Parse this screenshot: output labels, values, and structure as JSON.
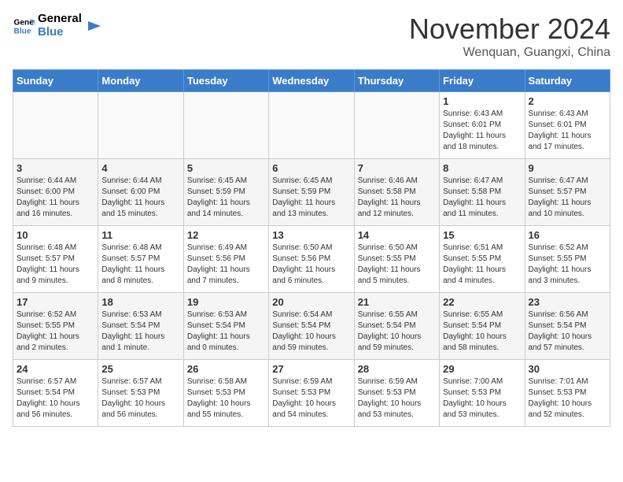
{
  "header": {
    "logo_line1": "General",
    "logo_line2": "Blue",
    "month": "November 2024",
    "location": "Wenquan, Guangxi, China"
  },
  "weekdays": [
    "Sunday",
    "Monday",
    "Tuesday",
    "Wednesday",
    "Thursday",
    "Friday",
    "Saturday"
  ],
  "weeks": [
    [
      {
        "day": "",
        "info": ""
      },
      {
        "day": "",
        "info": ""
      },
      {
        "day": "",
        "info": ""
      },
      {
        "day": "",
        "info": ""
      },
      {
        "day": "",
        "info": ""
      },
      {
        "day": "1",
        "info": "Sunrise: 6:43 AM\nSunset: 6:01 PM\nDaylight: 11 hours\nand 18 minutes."
      },
      {
        "day": "2",
        "info": "Sunrise: 6:43 AM\nSunset: 6:01 PM\nDaylight: 11 hours\nand 17 minutes."
      }
    ],
    [
      {
        "day": "3",
        "info": "Sunrise: 6:44 AM\nSunset: 6:00 PM\nDaylight: 11 hours\nand 16 minutes."
      },
      {
        "day": "4",
        "info": "Sunrise: 6:44 AM\nSunset: 6:00 PM\nDaylight: 11 hours\nand 15 minutes."
      },
      {
        "day": "5",
        "info": "Sunrise: 6:45 AM\nSunset: 5:59 PM\nDaylight: 11 hours\nand 14 minutes."
      },
      {
        "day": "6",
        "info": "Sunrise: 6:45 AM\nSunset: 5:59 PM\nDaylight: 11 hours\nand 13 minutes."
      },
      {
        "day": "7",
        "info": "Sunrise: 6:46 AM\nSunset: 5:58 PM\nDaylight: 11 hours\nand 12 minutes."
      },
      {
        "day": "8",
        "info": "Sunrise: 6:47 AM\nSunset: 5:58 PM\nDaylight: 11 hours\nand 11 minutes."
      },
      {
        "day": "9",
        "info": "Sunrise: 6:47 AM\nSunset: 5:57 PM\nDaylight: 11 hours\nand 10 minutes."
      }
    ],
    [
      {
        "day": "10",
        "info": "Sunrise: 6:48 AM\nSunset: 5:57 PM\nDaylight: 11 hours\nand 9 minutes."
      },
      {
        "day": "11",
        "info": "Sunrise: 6:48 AM\nSunset: 5:57 PM\nDaylight: 11 hours\nand 8 minutes."
      },
      {
        "day": "12",
        "info": "Sunrise: 6:49 AM\nSunset: 5:56 PM\nDaylight: 11 hours\nand 7 minutes."
      },
      {
        "day": "13",
        "info": "Sunrise: 6:50 AM\nSunset: 5:56 PM\nDaylight: 11 hours\nand 6 minutes."
      },
      {
        "day": "14",
        "info": "Sunrise: 6:50 AM\nSunset: 5:55 PM\nDaylight: 11 hours\nand 5 minutes."
      },
      {
        "day": "15",
        "info": "Sunrise: 6:51 AM\nSunset: 5:55 PM\nDaylight: 11 hours\nand 4 minutes."
      },
      {
        "day": "16",
        "info": "Sunrise: 6:52 AM\nSunset: 5:55 PM\nDaylight: 11 hours\nand 3 minutes."
      }
    ],
    [
      {
        "day": "17",
        "info": "Sunrise: 6:52 AM\nSunset: 5:55 PM\nDaylight: 11 hours\nand 2 minutes."
      },
      {
        "day": "18",
        "info": "Sunrise: 6:53 AM\nSunset: 5:54 PM\nDaylight: 11 hours\nand 1 minute."
      },
      {
        "day": "19",
        "info": "Sunrise: 6:53 AM\nSunset: 5:54 PM\nDaylight: 11 hours\nand 0 minutes."
      },
      {
        "day": "20",
        "info": "Sunrise: 6:54 AM\nSunset: 5:54 PM\nDaylight: 10 hours\nand 59 minutes."
      },
      {
        "day": "21",
        "info": "Sunrise: 6:55 AM\nSunset: 5:54 PM\nDaylight: 10 hours\nand 59 minutes."
      },
      {
        "day": "22",
        "info": "Sunrise: 6:55 AM\nSunset: 5:54 PM\nDaylight: 10 hours\nand 58 minutes."
      },
      {
        "day": "23",
        "info": "Sunrise: 6:56 AM\nSunset: 5:54 PM\nDaylight: 10 hours\nand 57 minutes."
      }
    ],
    [
      {
        "day": "24",
        "info": "Sunrise: 6:57 AM\nSunset: 5:54 PM\nDaylight: 10 hours\nand 56 minutes."
      },
      {
        "day": "25",
        "info": "Sunrise: 6:57 AM\nSunset: 5:53 PM\nDaylight: 10 hours\nand 56 minutes."
      },
      {
        "day": "26",
        "info": "Sunrise: 6:58 AM\nSunset: 5:53 PM\nDaylight: 10 hours\nand 55 minutes."
      },
      {
        "day": "27",
        "info": "Sunrise: 6:59 AM\nSunset: 5:53 PM\nDaylight: 10 hours\nand 54 minutes."
      },
      {
        "day": "28",
        "info": "Sunrise: 6:59 AM\nSunset: 5:53 PM\nDaylight: 10 hours\nand 53 minutes."
      },
      {
        "day": "29",
        "info": "Sunrise: 7:00 AM\nSunset: 5:53 PM\nDaylight: 10 hours\nand 53 minutes."
      },
      {
        "day": "30",
        "info": "Sunrise: 7:01 AM\nSunset: 5:53 PM\nDaylight: 10 hours\nand 52 minutes."
      }
    ]
  ]
}
